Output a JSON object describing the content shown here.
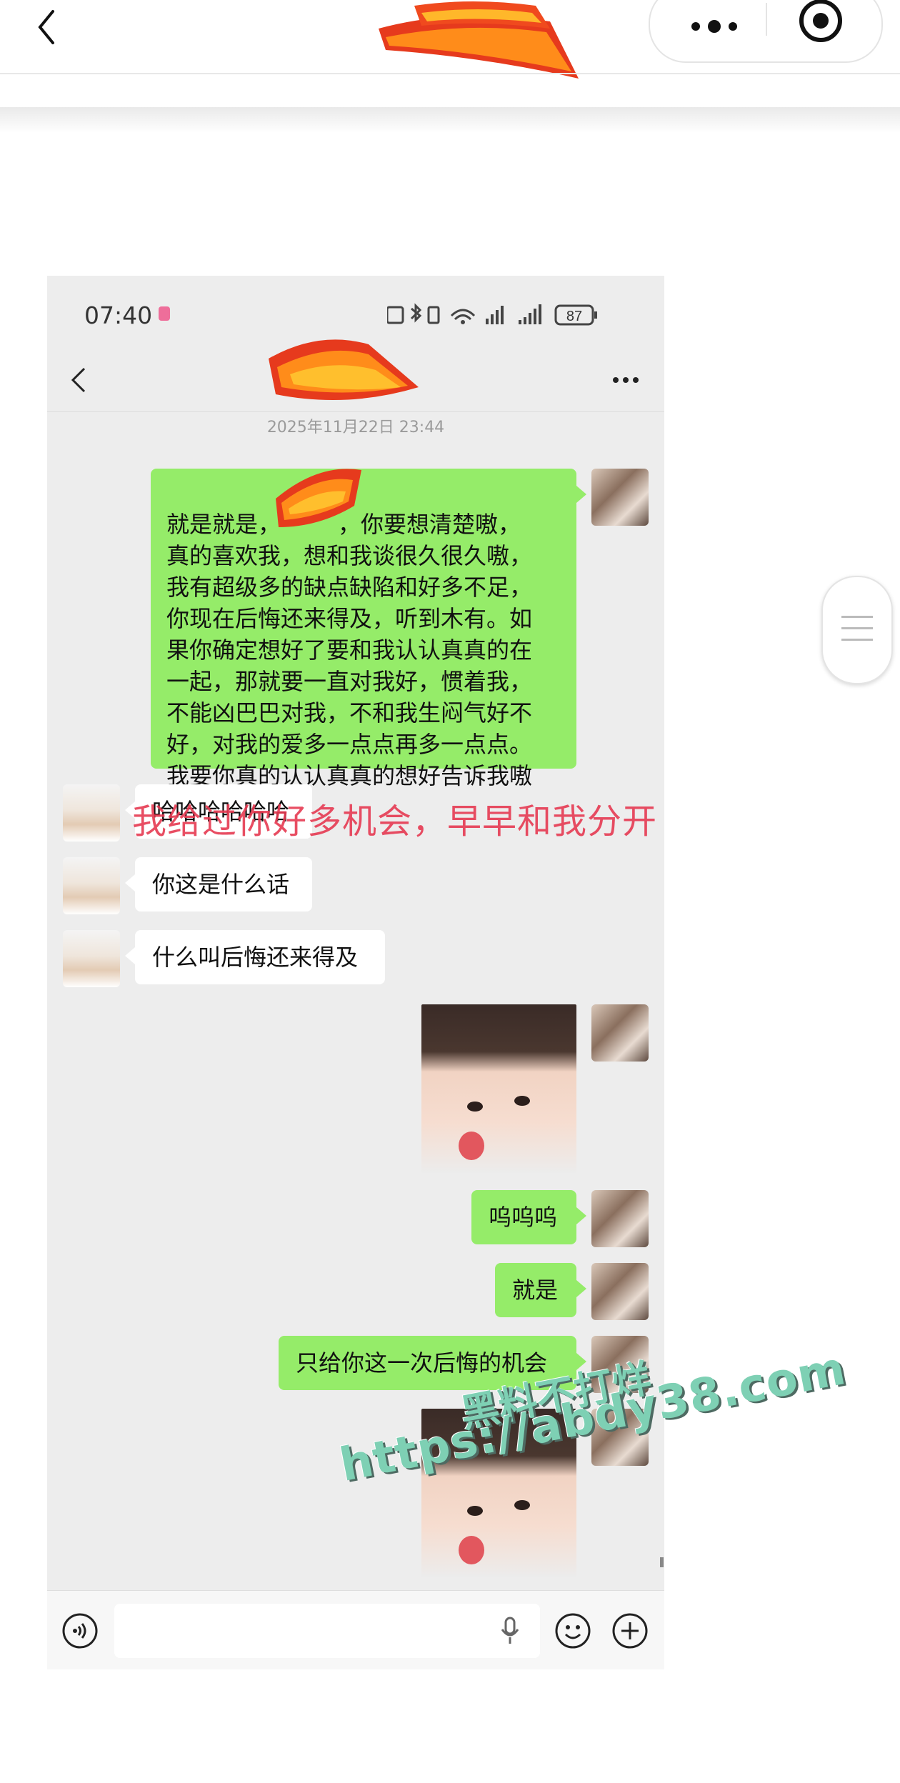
{
  "outer_page": {
    "back_icon": "chevron-left-icon",
    "menu_icons": [
      "more-dots-icon",
      "target-circle-icon"
    ]
  },
  "chat_screenshot": {
    "status_bar": {
      "time": "07:40",
      "battery": "87",
      "icons": [
        "nfc-icon",
        "bluetooth-icon",
        "vibrate-icon",
        "wifi-icon",
        "signal-icon",
        "signal-icon",
        "battery-icon"
      ]
    },
    "header": {
      "back_icon": "chevron-left-icon",
      "more_icon": "more-dots-icon"
    },
    "timestamp": "2025年11月22日 23:44",
    "messages": [
      {
        "sender": "me",
        "text": "就是就是，　　　，你要想清楚嗷，\n真的喜欢我，想和我谈很久很久嗷，\n我有超级多的缺点缺陷和好多不足，\n你现在后悔还来得及，听到木有。如\n果你确定想好了要和我认认真真的在\n一起，那就要一直对我好，惯着我，\n不能凶巴巴对我，不和我生闷气好不\n好，对我的爱多一点点再多一点点。\n我要你真的认认真真的想好告诉我嗷"
      },
      {
        "sender": "other",
        "text": "哈哈哈哈哈哈"
      },
      {
        "sender": "other",
        "text": "你这是什么话"
      },
      {
        "sender": "other",
        "text": "什么叫后悔还来得及"
      },
      {
        "sender": "me",
        "type": "sticker"
      },
      {
        "sender": "me",
        "text": "呜呜呜"
      },
      {
        "sender": "me",
        "text": "就是"
      },
      {
        "sender": "me",
        "text": "只给你这一次后悔的机会"
      },
      {
        "sender": "me",
        "type": "sticker"
      }
    ],
    "input_bar": {
      "voice_icon": "voice-icon",
      "mic_icon": "mic-icon",
      "emoji_icon": "emoji-icon",
      "plus_icon": "plus-icon"
    }
  },
  "overlay_caption": "我给过你好多机会，早早和我分开",
  "watermark": {
    "line1": "黑料不打烊",
    "line2": "https://abdy38.com"
  },
  "colors": {
    "my_bubble": "#95ec69",
    "other_bubble": "#ffffff",
    "chat_bg": "#ededed",
    "caption": "#e63a52",
    "watermark": "#7ed0b4"
  }
}
